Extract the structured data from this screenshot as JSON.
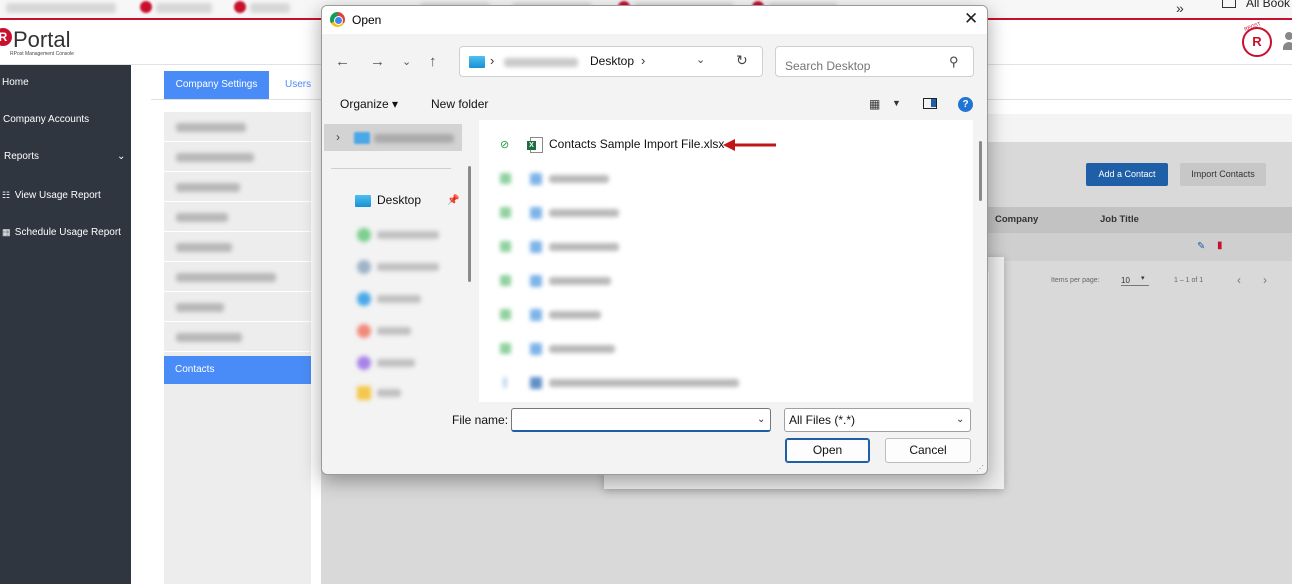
{
  "browser": {
    "allbook_label": "All Book"
  },
  "app": {
    "logo_letter": "R",
    "logo_text": "Portal",
    "logo_sub": "RPost Management Console",
    "user_badge_letter": "R",
    "user_badge_top": "RPOST"
  },
  "sidebar": {
    "items": [
      {
        "label": "Home",
        "icon": ""
      },
      {
        "label": "Company Accounts",
        "icon": ""
      },
      {
        "label": "Reports",
        "icon": ""
      },
      {
        "label": "View Usage Report",
        "icon": "☷"
      },
      {
        "label": "Schedule Usage Report",
        "icon": "▦"
      }
    ],
    "reports_chevron": "⌄"
  },
  "content": {
    "tabs": {
      "company_settings": "Company Settings",
      "users": "Users"
    },
    "subnav_active": "Contacts",
    "add_contact": "Add a Contact",
    "import_contacts": "Import Contacts",
    "table_headers": {
      "company": "Company",
      "job_title": "Job Title"
    },
    "items_per_page_label": "Items per page:",
    "items_per_page_value": "10",
    "range_label": "1 – 1 of 1"
  },
  "dialog": {
    "title": "Open",
    "close_glyph": "✕",
    "address": {
      "current_folder": "Desktop",
      "separator": "›"
    },
    "search_placeholder": "Search Desktop",
    "toolbar": {
      "organize": "Organize ▾",
      "new_folder": "New folder",
      "help": "?"
    },
    "nav_pane": {
      "desktop_label": "Desktop"
    },
    "files": [
      {
        "name": "Contacts Sample Import File.xlsx",
        "type": "xlsx",
        "status": "synced"
      }
    ],
    "file_name_label": "File name:",
    "file_name_value": "",
    "file_type_value": "All Files (*.*)",
    "open_button": "Open",
    "cancel_button": "Cancel"
  },
  "colors": {
    "brand_red": "#c8102e",
    "tab_blue": "#4a8cf7",
    "sidebar_bg": "#2f3640",
    "annotation_arrow": "#c0151b"
  }
}
